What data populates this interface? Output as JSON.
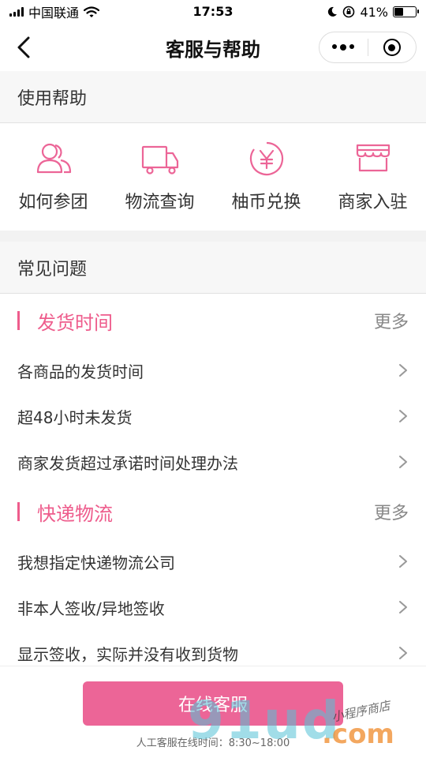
{
  "status_bar": {
    "carrier": "中国联通",
    "time": "17:53",
    "battery": "41%",
    "battery_level": 0.41
  },
  "nav": {
    "title": "客服与帮助"
  },
  "help_section": {
    "title": "使用帮助",
    "items": [
      {
        "label": "如何参团",
        "icon": "group-users-icon"
      },
      {
        "label": "物流查询",
        "icon": "delivery-truck-icon"
      },
      {
        "label": "柚币兑换",
        "icon": "yen-coin-icon"
      },
      {
        "label": "商家入驻",
        "icon": "storefront-icon"
      }
    ]
  },
  "faq_section": {
    "title": "常见问题",
    "categories": [
      {
        "name": "发货时间",
        "more": "更多",
        "questions": [
          "各商品的发货时间",
          "超48小时未发货",
          "商家发货超过承诺时间处理办法"
        ]
      },
      {
        "name": "快递物流",
        "more": "更多",
        "questions": [
          "我想指定快递物流公司",
          "非本人签收/异地签收",
          "显示签收，实际并没有收到货物"
        ]
      }
    ]
  },
  "footer": {
    "button_label": "在线客服",
    "hours_text": "人工客服在线时间：8:30~18:00"
  },
  "watermark": {
    "main": "91ud",
    "com": ".com",
    "script": "小程序商店"
  },
  "colors": {
    "accent": "#ec6597",
    "category": "#ee5c8c"
  }
}
